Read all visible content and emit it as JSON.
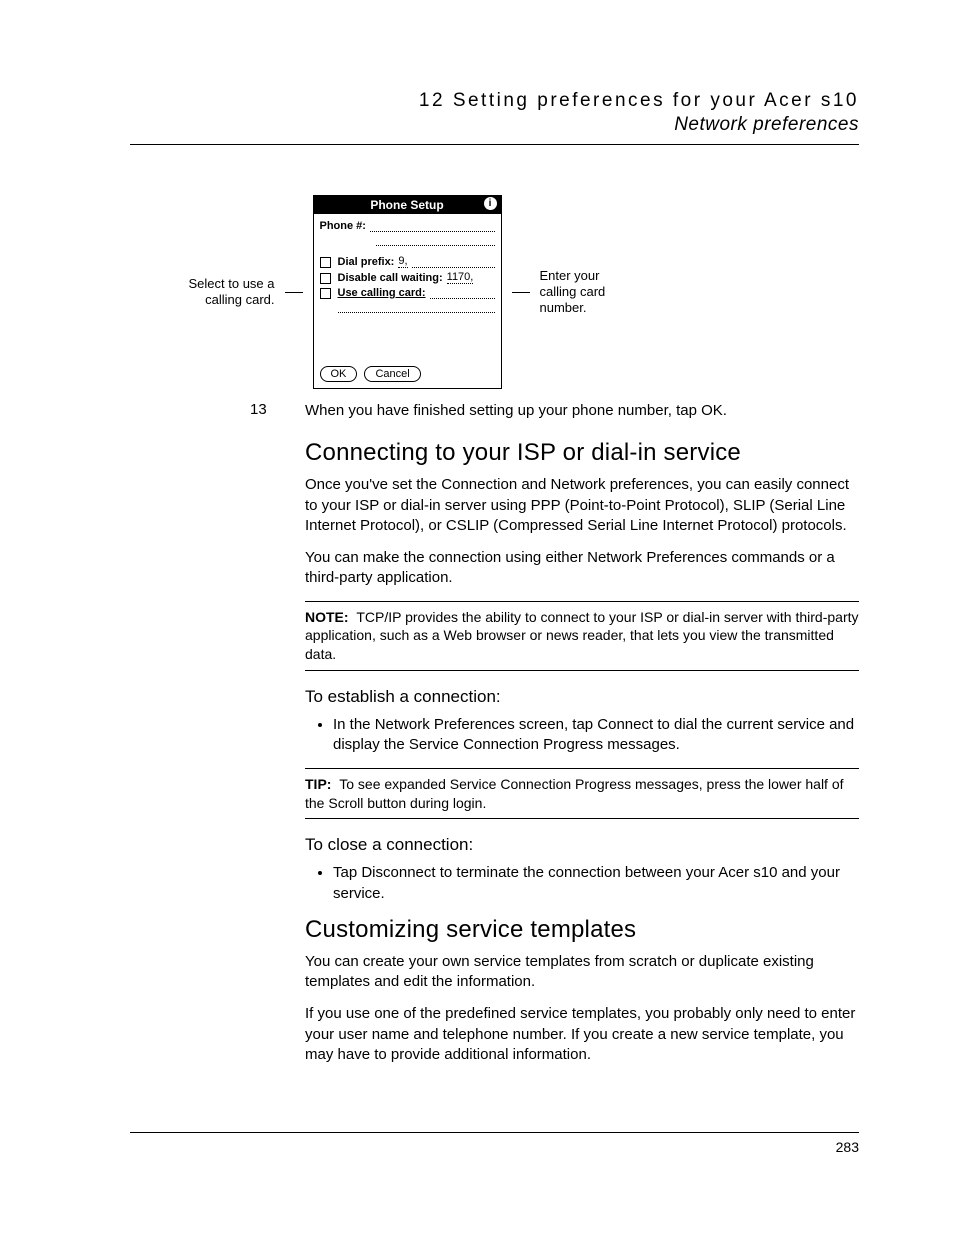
{
  "header": {
    "chapter": "12 Setting preferences for your Acer s10",
    "section": "Network preferences"
  },
  "figure": {
    "left_caption": "Select to use a calling card.",
    "right_caption": "Enter your calling card number.",
    "title": "Phone Setup",
    "phone_label": "Phone #:",
    "dial_prefix_label": "Dial prefix:",
    "dial_prefix_value": "9,",
    "disable_cw_label": "Disable call waiting:",
    "disable_cw_value": "1170,",
    "use_card_label": "Use calling card:",
    "ok": "OK",
    "cancel": "Cancel",
    "info_glyph": "i"
  },
  "step": {
    "num": "13",
    "text": "When you have finished setting up your phone number, tap OK."
  },
  "s1": {
    "h": "Connecting to your ISP or dial-in service",
    "p1": "Once you've set the Connection and Network preferences, you can easily connect to your ISP or dial-in server using PPP (Point-to-Point Protocol), SLIP (Serial Line Internet Protocol), or CSLIP (Compressed Serial Line Internet Protocol) protocols.",
    "p2": "You can make the connection using either Network Preferences commands or a third-party application."
  },
  "note1": {
    "label": "NOTE:",
    "text": "TCP/IP provides the ability to connect to your ISP or dial-in server with third-party application, such as a Web browser or news reader, that lets you view the transmitted data."
  },
  "s2": {
    "h": "To establish a connection:",
    "b1": "In the Network Preferences screen, tap Connect to dial the current service and display the Service Connection Progress messages."
  },
  "tip": {
    "label": "TIP:",
    "text": "To see expanded Service Connection Progress messages, press the lower half of the Scroll button during login."
  },
  "s3": {
    "h": "To close a connection:",
    "b1": "Tap Disconnect to terminate the connection between your Acer s10 and your service."
  },
  "s4": {
    "h": "Customizing service templates",
    "p1": "You can create your own service templates from scratch or duplicate existing templates and edit the information.",
    "p2": "If you use one of the predefined service templates, you probably only need to enter your user name and telephone number. If you create a new service template, you may have to provide additional information."
  },
  "page_number": "283"
}
